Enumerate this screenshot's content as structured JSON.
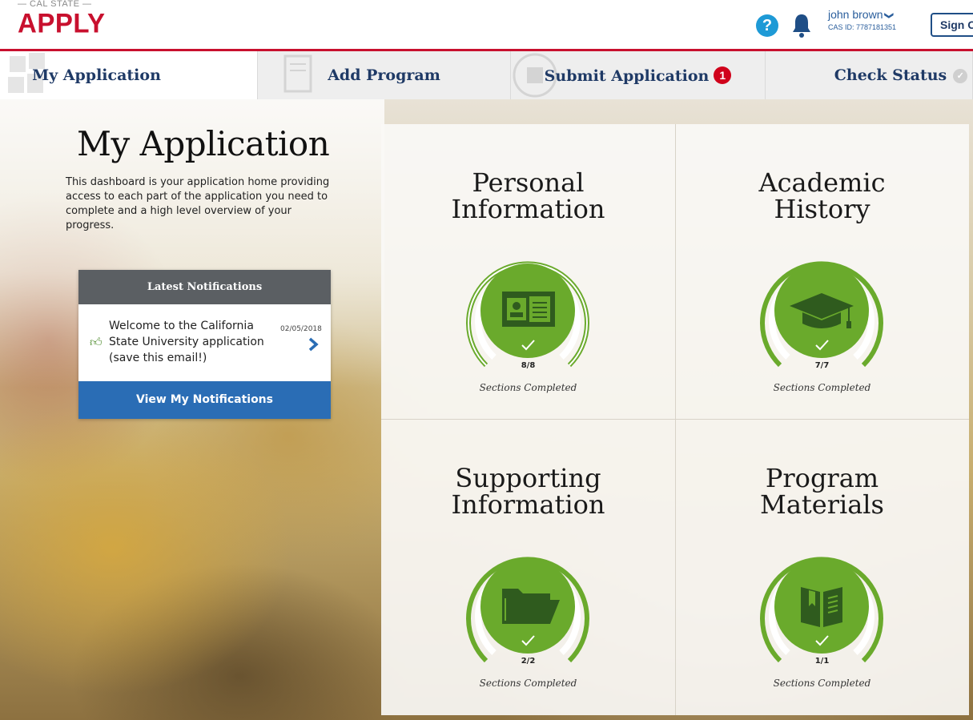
{
  "header": {
    "logo_top": "— CAL STATE —",
    "logo_main": "APPLY",
    "help_glyph": "?",
    "user_name": "john brown",
    "user_chevron": "❯",
    "cas_id": "CAS ID: 7787181351",
    "sign_out_label": "Sign O"
  },
  "nav": {
    "tabs": [
      {
        "label": "My Application",
        "active": true
      },
      {
        "label": "Add Program"
      },
      {
        "label": "Submit Application",
        "badge": "1"
      },
      {
        "label": "Check Status",
        "status_glyph": "✓"
      }
    ]
  },
  "intro": {
    "title": "My Application",
    "text": "This dashboard is your application home providing access to each part of the application you need to complete and a high level overview of your progress."
  },
  "notifications": {
    "header": "Latest Notifications",
    "item_text": "Welcome to the California State University application (save this email!)",
    "item_date": "02/05/2018",
    "button_label": "View My Notifications"
  },
  "sections": [
    {
      "title_line1": "Personal",
      "title_line2": "Information",
      "count": "8/8",
      "completed_label": "Sections Completed",
      "icon": "id-card-icon",
      "progress": 1.0
    },
    {
      "title_line1": "Academic",
      "title_line2": "History",
      "count": "7/7",
      "completed_label": "Sections Completed",
      "icon": "graduation-cap-icon",
      "progress": 1.0
    },
    {
      "title_line1": "Supporting",
      "title_line2": "Information",
      "count": "2/2",
      "completed_label": "Sections Completed",
      "icon": "folder-icon",
      "progress": 1.0
    },
    {
      "title_line1": "Program",
      "title_line2": "Materials",
      "count": "1/1",
      "completed_label": "Sections Completed",
      "icon": "book-icon",
      "progress": 1.0
    }
  ],
  "colors": {
    "brand_red": "#c8102e",
    "navy": "#1f3a66",
    "accent_green": "#6aaa2c",
    "button_blue": "#2a6db5",
    "badge_red": "#d0021b"
  }
}
